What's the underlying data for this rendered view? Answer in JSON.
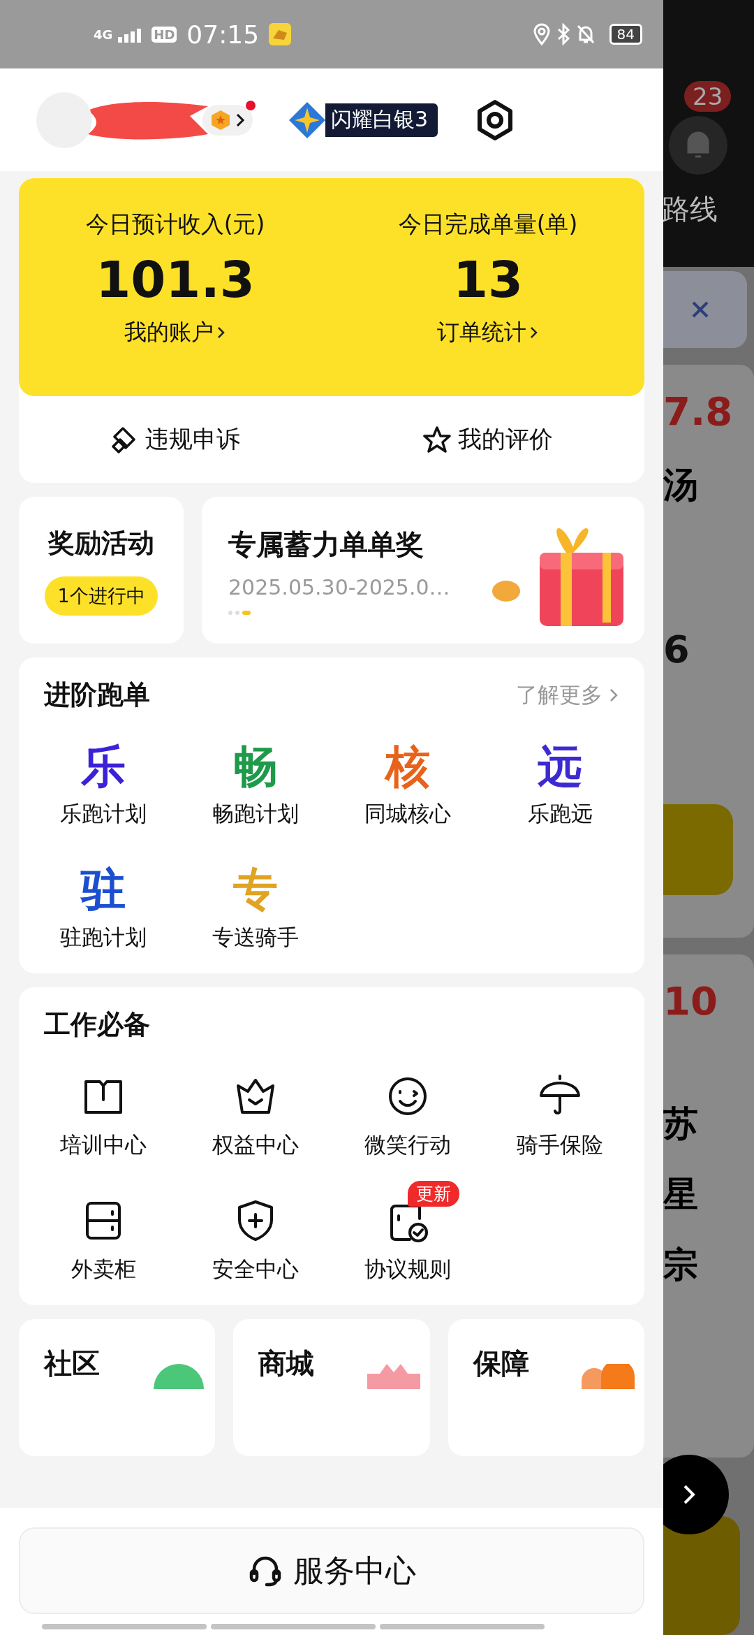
{
  "status_bar": {
    "network": "4G",
    "hd": "HD",
    "time": "07:15",
    "battery": "84"
  },
  "header": {
    "unread_dot": true,
    "level_badge": "闪耀白银3"
  },
  "earnings": [
    {
      "label": "今日预计收入(元)",
      "value": "101.3",
      "link": "我的账户"
    },
    {
      "label": "今日完成单量(单)",
      "value": "13",
      "link": "订单统计"
    }
  ],
  "quick_links": [
    {
      "label": "违规申诉"
    },
    {
      "label": "我的评价"
    }
  ],
  "rewards": {
    "title": "奖励活动",
    "badge": "1个进行中",
    "promo_title": "专属蓄力单单奖",
    "promo_dates": "2025.05.30-2025.0…",
    "pages": [
      {
        "selected": false
      },
      {
        "selected": false
      },
      {
        "selected": true
      }
    ]
  },
  "advanced": {
    "title": "进阶跑单",
    "more": "了解更多",
    "items": [
      {
        "glyph": "乐",
        "label": "乐跑计划",
        "color": "#3b22d8"
      },
      {
        "glyph": "畅",
        "label": "畅跑计划",
        "color": "#1e9a4a"
      },
      {
        "glyph": "核",
        "label": "同城核心",
        "color": "#e8621a"
      },
      {
        "glyph": "远",
        "label": "乐跑远",
        "color": "#3c2bd0"
      },
      {
        "glyph": "驻",
        "label": "驻跑计划",
        "color": "#1c4fd0"
      },
      {
        "glyph": "专",
        "label": "专送骑手",
        "color": "#e0a322"
      }
    ]
  },
  "work": {
    "title": "工作必备",
    "items": [
      {
        "label": "培训中心"
      },
      {
        "label": "权益中心"
      },
      {
        "label": "微笑行动"
      },
      {
        "label": "骑手保险"
      },
      {
        "label": "外卖柜"
      },
      {
        "label": "安全中心"
      },
      {
        "label": "协议规则",
        "badge": "更新"
      }
    ]
  },
  "bottom_cards": [
    {
      "title": "社区"
    },
    {
      "title": "商城"
    },
    {
      "title": "保障"
    }
  ],
  "service_button": "服务中心",
  "background_page": {
    "notification_count": "23",
    "tab": "路线",
    "price_1": "7.8",
    "name_1": "汤",
    "value_1": "6",
    "price_2": "10",
    "name_2": [
      "苏",
      "星",
      "宗"
    ]
  }
}
